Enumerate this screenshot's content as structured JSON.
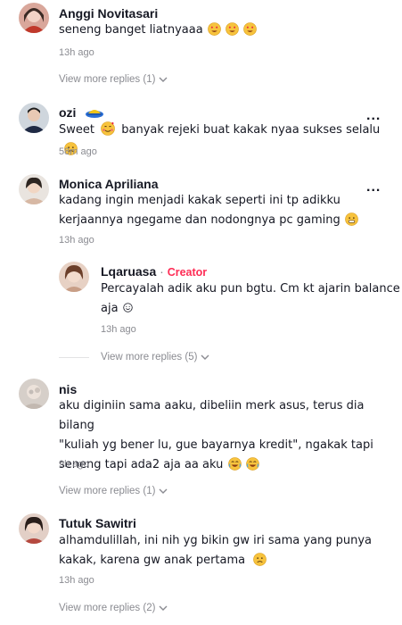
{
  "comments": [
    {
      "name": "Anggi Novitasari",
      "text": "seneng banget liatnyaaa",
      "emoji": [
        "heart-eyes",
        "heart-eyes",
        "heart-eyes"
      ],
      "time": "13h ago",
      "view_replies": "View more replies (1)"
    },
    {
      "name": "ozi",
      "text": "Sweet",
      "text2": "banyak rejeki buat kakak nyaa sukses selalu",
      "time": "58m ago",
      "more": "..."
    },
    {
      "name": "Monica Apriliana",
      "text_line1": "kadang ingin menjadi kakak seperti ini tp adikku",
      "text_line2": "kerjaannya ngegame dan nodongnya pc gaming",
      "time": "13h ago",
      "more": "...",
      "reply": {
        "name": "Lqaruasa",
        "separator": "·",
        "creator_label": "Creator",
        "text_line1": "Percayalah adik aku pun bgtu. Cm kt ajarin balance",
        "text_line2": "aja",
        "time": "13h ago"
      },
      "view_replies": "View more replies (5)"
    },
    {
      "name": "nis",
      "text_line1": "aku diginiin sama aaku, dibeliin merk asus, terus dia bilang",
      "text_line2": "\"kuliah yg bener lu, gue bayarnya kredit\", ngakak tapi",
      "text_line3": "seneng tapi ada2 aja aa aku",
      "time": "9h ago",
      "view_replies": "View more replies (1)"
    },
    {
      "name": "Tutuk Sawitri",
      "text_line1": "alhamdulillah, ini nih yg bikin gw iri sama yang punya",
      "text_line2": "kakak, karena gw anak pertama",
      "time": "13h ago",
      "view_replies": "View more replies (2)"
    }
  ],
  "colors": {
    "text": "#161823",
    "muted": "#8a8b91",
    "creator": "#fe2c55"
  }
}
